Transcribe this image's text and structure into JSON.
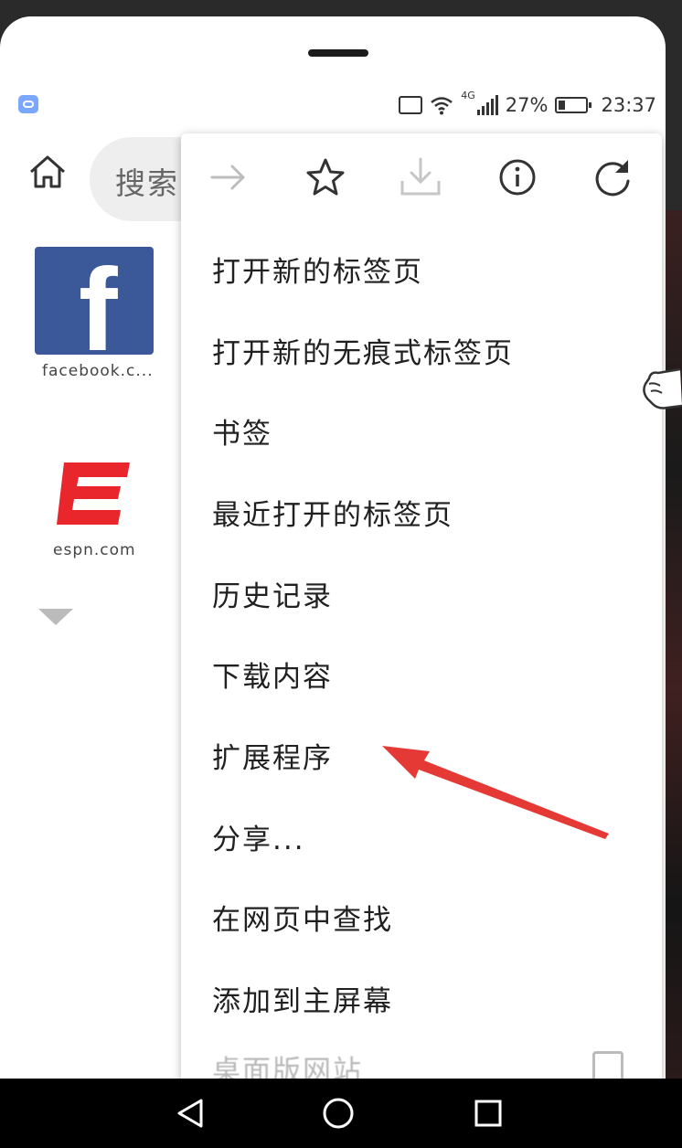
{
  "status_bar": {
    "network": "4G",
    "battery": "27%",
    "time": "23:37"
  },
  "toolbar": {
    "search_placeholder": "搜索"
  },
  "shortcuts": [
    {
      "label": "facebook.c..."
    },
    {
      "label": "espn.com"
    }
  ],
  "menu": {
    "icons": [
      "forward-icon",
      "star-icon",
      "download-icon",
      "info-icon",
      "refresh-icon"
    ],
    "items": [
      "打开新的标签页",
      "打开新的无痕式标签页",
      "书签",
      "最近打开的标签页",
      "历史记录",
      "下载内容",
      "扩展程序",
      "分享...",
      "在网页中查找",
      "添加到主屏幕"
    ],
    "partial_item": "桌面版网站"
  },
  "colors": {
    "facebook_blue": "#3b5998",
    "espn_red": "#e8262c",
    "annotation_red": "#e53935"
  }
}
